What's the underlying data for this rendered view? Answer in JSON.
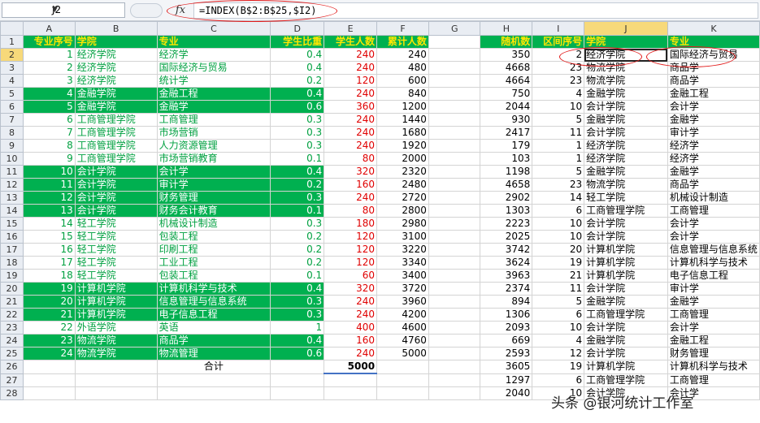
{
  "formula_bar": {
    "name_box": "J2",
    "fx_icon": "fx",
    "formula": "=INDEX(B$2:B$25,$I2)"
  },
  "columns": [
    "A",
    "B",
    "C",
    "D",
    "E",
    "F",
    "G",
    "H",
    "I",
    "J",
    "K"
  ],
  "header": {
    "A": "专业序号",
    "B": "学院",
    "C": "专业",
    "D": "学生比重",
    "E": "学生人数",
    "F": "累计人数",
    "G": "",
    "H": "随机数",
    "I": "区间序号",
    "J": "学院",
    "K": "专业"
  },
  "rows": [
    {
      "n": "2",
      "a": "1",
      "b": "经济学院",
      "c": "经济学",
      "d": "0.4",
      "e": "240",
      "f": "240",
      "h": "350",
      "i": "2",
      "j": "经济学院",
      "k": "国际经济与贸易"
    },
    {
      "n": "3",
      "a": "2",
      "b": "经济学院",
      "c": "国际经济与贸易",
      "d": "0.4",
      "e": "240",
      "f": "480",
      "h": "4668",
      "i": "23",
      "j": "物流学院",
      "k": "商品学"
    },
    {
      "n": "4",
      "a": "3",
      "b": "经济学院",
      "c": "统计学",
      "d": "0.2",
      "e": "120",
      "f": "600",
      "h": "4664",
      "i": "23",
      "j": "物流学院",
      "k": "商品学"
    },
    {
      "n": "5",
      "a": "4",
      "b": "金融学院",
      "c": "金融工程",
      "d": "0.4",
      "e": "240",
      "f": "840",
      "h": "750",
      "i": "4",
      "j": "金融学院",
      "k": "金融工程"
    },
    {
      "n": "6",
      "a": "5",
      "b": "金融学院",
      "c": "金融学",
      "d": "0.6",
      "e": "360",
      "f": "1200",
      "h": "2044",
      "i": "10",
      "j": "会计学院",
      "k": "会计学"
    },
    {
      "n": "7",
      "a": "6",
      "b": "工商管理学院",
      "c": "工商管理",
      "d": "0.3",
      "e": "240",
      "f": "1440",
      "h": "930",
      "i": "5",
      "j": "金融学院",
      "k": "金融学"
    },
    {
      "n": "8",
      "a": "7",
      "b": "工商管理学院",
      "c": "市场营销",
      "d": "0.3",
      "e": "240",
      "f": "1680",
      "h": "2417",
      "i": "11",
      "j": "会计学院",
      "k": "审计学"
    },
    {
      "n": "9",
      "a": "8",
      "b": "工商管理学院",
      "c": "人力资源管理",
      "d": "0.3",
      "e": "240",
      "f": "1920",
      "h": "179",
      "i": "1",
      "j": "经济学院",
      "k": "经济学"
    },
    {
      "n": "10",
      "a": "9",
      "b": "工商管理学院",
      "c": "市场营销教育",
      "d": "0.1",
      "e": "80",
      "f": "2000",
      "h": "103",
      "i": "1",
      "j": "经济学院",
      "k": "经济学"
    },
    {
      "n": "11",
      "a": "10",
      "b": "会计学院",
      "c": "会计学",
      "d": "0.4",
      "e": "320",
      "f": "2320",
      "h": "1198",
      "i": "5",
      "j": "金融学院",
      "k": "金融学"
    },
    {
      "n": "12",
      "a": "11",
      "b": "会计学院",
      "c": "审计学",
      "d": "0.2",
      "e": "160",
      "f": "2480",
      "h": "4658",
      "i": "23",
      "j": "物流学院",
      "k": "商品学"
    },
    {
      "n": "13",
      "a": "12",
      "b": "会计学院",
      "c": "财务管理",
      "d": "0.3",
      "e": "240",
      "f": "2720",
      "h": "2902",
      "i": "14",
      "j": "轻工学院",
      "k": "机械设计制造"
    },
    {
      "n": "14",
      "a": "13",
      "b": "会计学院",
      "c": "财务会计教育",
      "d": "0.1",
      "e": "80",
      "f": "2800",
      "h": "1303",
      "i": "6",
      "j": "工商管理学院",
      "k": "工商管理"
    },
    {
      "n": "15",
      "a": "14",
      "b": "轻工学院",
      "c": "机械设计制造",
      "d": "0.3",
      "e": "180",
      "f": "2980",
      "h": "2223",
      "i": "10",
      "j": "会计学院",
      "k": "会计学"
    },
    {
      "n": "16",
      "a": "15",
      "b": "轻工学院",
      "c": "包装工程",
      "d": "0.2",
      "e": "120",
      "f": "3100",
      "h": "2025",
      "i": "10",
      "j": "会计学院",
      "k": "会计学"
    },
    {
      "n": "17",
      "a": "16",
      "b": "轻工学院",
      "c": "印刷工程",
      "d": "0.2",
      "e": "120",
      "f": "3220",
      "h": "3742",
      "i": "20",
      "j": "计算机学院",
      "k": "信息管理与信息系统"
    },
    {
      "n": "18",
      "a": "17",
      "b": "轻工学院",
      "c": "工业工程",
      "d": "0.2",
      "e": "120",
      "f": "3340",
      "h": "3624",
      "i": "19",
      "j": "计算机学院",
      "k": "计算机科学与技术"
    },
    {
      "n": "19",
      "a": "18",
      "b": "轻工学院",
      "c": "包装工程",
      "d": "0.1",
      "e": "60",
      "f": "3400",
      "h": "3963",
      "i": "21",
      "j": "计算机学院",
      "k": "电子信息工程"
    },
    {
      "n": "20",
      "a": "19",
      "b": "计算机学院",
      "c": "计算机科学与技术",
      "d": "0.4",
      "e": "320",
      "f": "3720",
      "h": "2374",
      "i": "11",
      "j": "会计学院",
      "k": "审计学"
    },
    {
      "n": "21",
      "a": "20",
      "b": "计算机学院",
      "c": "信息管理与信息系统",
      "d": "0.3",
      "e": "240",
      "f": "3960",
      "h": "894",
      "i": "5",
      "j": "金融学院",
      "k": "金融学"
    },
    {
      "n": "22",
      "a": "21",
      "b": "计算机学院",
      "c": "电子信息工程",
      "d": "0.3",
      "e": "240",
      "f": "4200",
      "h": "1306",
      "i": "6",
      "j": "工商管理学院",
      "k": "工商管理"
    },
    {
      "n": "23",
      "a": "22",
      "b": "外语学院",
      "c": "英语",
      "d": "1",
      "e": "400",
      "f": "4600",
      "h": "2093",
      "i": "10",
      "j": "会计学院",
      "k": "会计学"
    },
    {
      "n": "24",
      "a": "23",
      "b": "物流学院",
      "c": "商品学",
      "d": "0.4",
      "e": "160",
      "f": "4760",
      "h": "669",
      "i": "4",
      "j": "金融学院",
      "k": "金融工程"
    },
    {
      "n": "25",
      "a": "24",
      "b": "物流学院",
      "c": "物流管理",
      "d": "0.6",
      "e": "240",
      "f": "5000",
      "h": "2593",
      "i": "12",
      "j": "会计学院",
      "k": "财务管理"
    },
    {
      "n": "26",
      "a": "",
      "b": "",
      "c": "合计",
      "d": "",
      "e": "5000",
      "f": "",
      "h": "3605",
      "i": "19",
      "j": "计算机学院",
      "k": "计算机科学与技术"
    },
    {
      "n": "27",
      "a": "",
      "b": "",
      "c": "",
      "d": "",
      "e": "",
      "f": "",
      "h": "1297",
      "i": "6",
      "j": "工商管理学院",
      "k": "工商管理"
    },
    {
      "n": "28",
      "a": "",
      "b": "",
      "c": "",
      "d": "",
      "e": "",
      "f": "",
      "h": "2040",
      "i": "10",
      "j": "会计学院",
      "k": "会计学"
    }
  ],
  "green_rows": [
    2,
    3,
    4,
    5,
    6,
    7,
    8,
    9,
    10,
    11,
    12,
    13,
    14,
    15,
    16,
    17,
    18,
    19,
    20,
    21,
    22,
    23,
    24,
    25
  ],
  "green_fill_rows": [
    5,
    6,
    11,
    12,
    13,
    14,
    20,
    21,
    22,
    24,
    25
  ],
  "watermark": "头条 @银河统计工作室",
  "colors": {
    "green": "#00b050",
    "header_text": "#ffe600",
    "red": "#e00000",
    "annotation": "#e21b1b"
  }
}
